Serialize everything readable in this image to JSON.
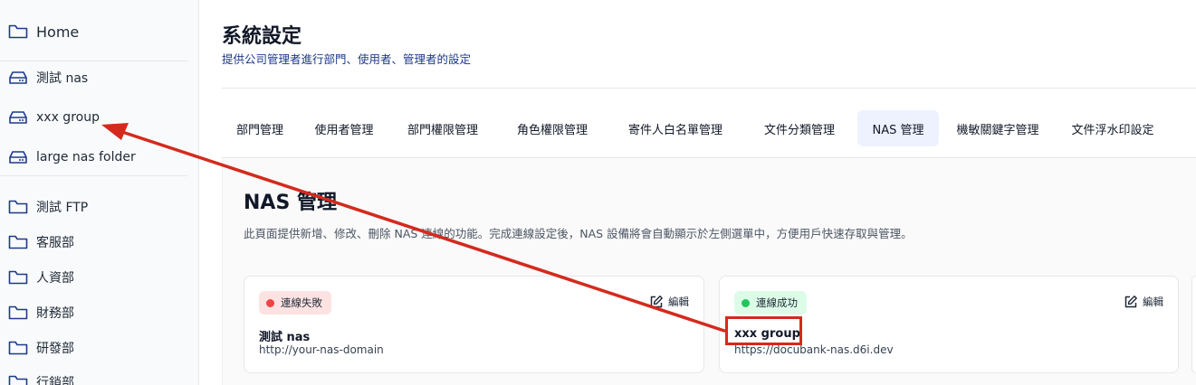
{
  "sidebar": {
    "home": "Home",
    "nas_items": [
      {
        "label": "測試 nas"
      },
      {
        "label": "xxx group"
      },
      {
        "label": "large nas folder"
      }
    ],
    "folders": [
      {
        "label": "測試 FTP"
      },
      {
        "label": "客服部"
      },
      {
        "label": "人資部"
      },
      {
        "label": "財務部"
      },
      {
        "label": "研發部"
      },
      {
        "label": "行銷部"
      }
    ]
  },
  "header": {
    "title": "系統設定",
    "subtitle": "提供公司管理者進行部門、使用者、管理者的設定"
  },
  "tabs": [
    {
      "label": "部門管理"
    },
    {
      "label": "使用者管理"
    },
    {
      "label": "部門權限管理"
    },
    {
      "label": "角色權限管理"
    },
    {
      "label": "寄件人白名單管理"
    },
    {
      "label": "文件分類管理"
    },
    {
      "label": "NAS 管理",
      "active": true
    },
    {
      "label": "機敏關鍵字管理"
    },
    {
      "label": "文件浮水印設定"
    }
  ],
  "section": {
    "title": "NAS 管理",
    "description": "此頁面提供新增、修改、刪除 NAS 連線的功能。完成連線設定後，NAS 設備將會自動顯示於左側選單中，方便用戶快速存取與管理。"
  },
  "cards": [
    {
      "status": "連線失敗",
      "status_kind": "error",
      "edit_label": "編輯",
      "name": "測試 nas",
      "url": "http://your-nas-domain"
    },
    {
      "status": "連線成功",
      "status_kind": "success",
      "edit_label": "編輯",
      "name": "xxx group",
      "url": "https://docubank-nas.d6i.dev"
    }
  ],
  "colors": {
    "accent_annotation": "#d42a1d",
    "active_tab_bg": "#eef2ff",
    "error_dot": "#ef4444",
    "success_dot": "#22c55e",
    "subtitle_text": "#1e3a8a"
  }
}
